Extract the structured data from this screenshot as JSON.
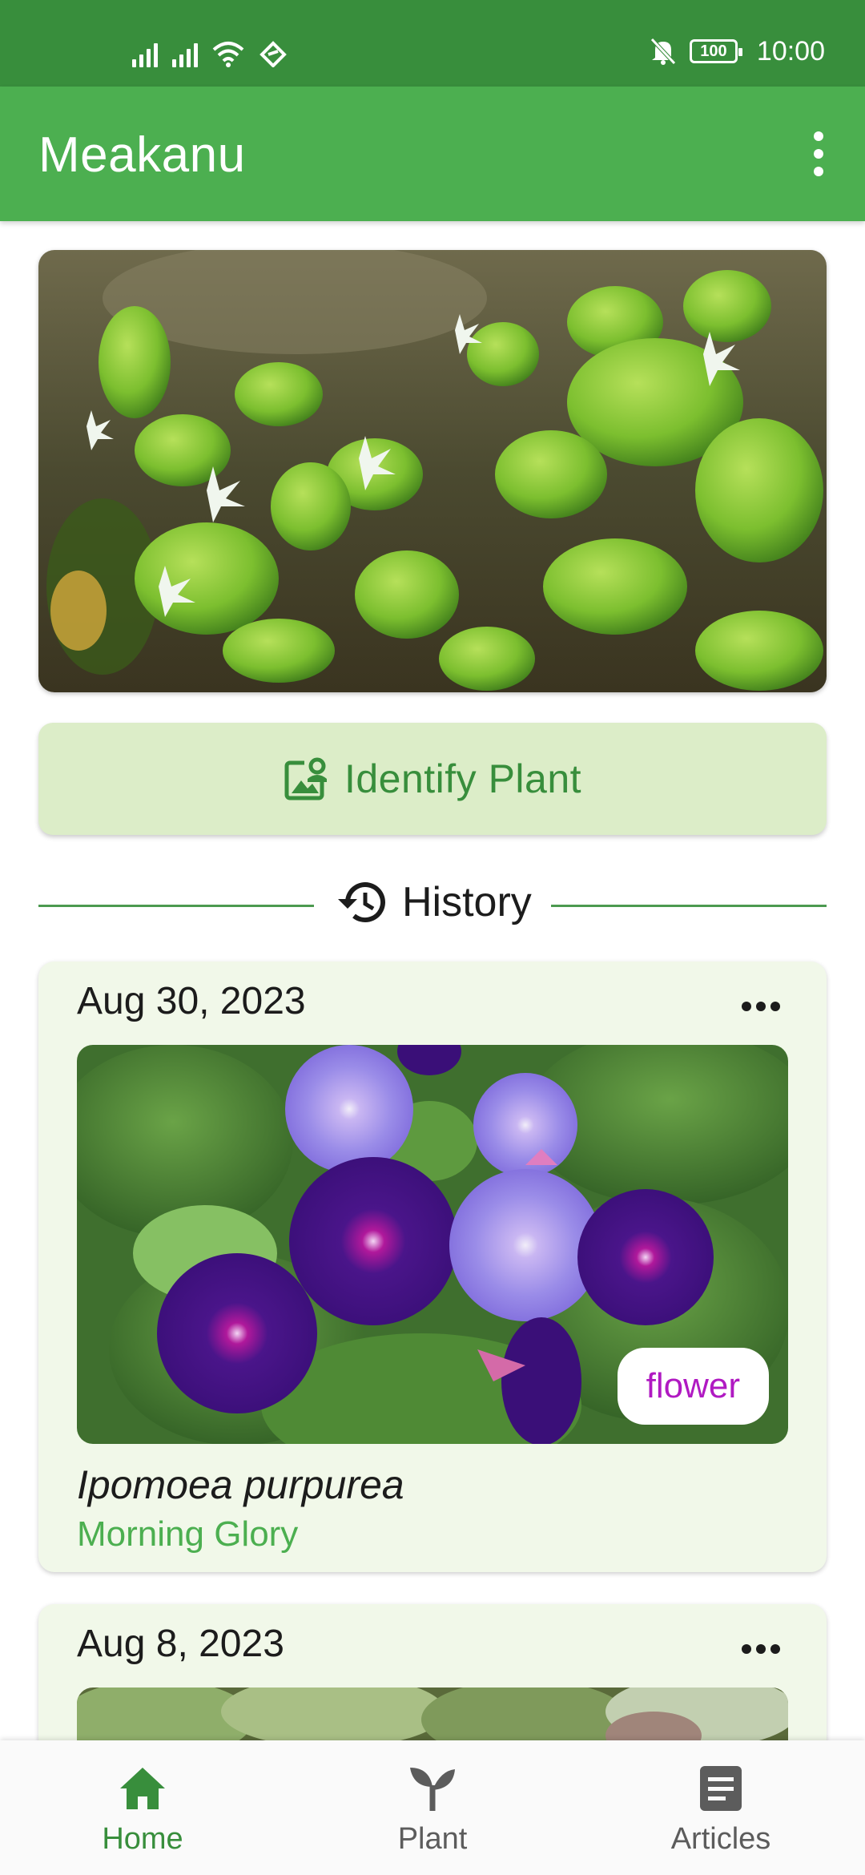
{
  "status_bar": {
    "time": "10:00",
    "battery": "100",
    "icons": [
      "signal-icon",
      "signal-icon",
      "wifi-icon",
      "nfc-icon",
      "mute-icon",
      "battery-icon"
    ]
  },
  "app_bar": {
    "title": "Meakanu",
    "menu_icon": "more-vertical-icon"
  },
  "identify_button": {
    "label": "Identify Plant",
    "icon": "image-search-icon"
  },
  "history": {
    "label": "History",
    "icon": "history-icon"
  },
  "cards": [
    {
      "date": "Aug 30, 2023",
      "tag": "flower",
      "scientific_name": "Ipomoea purpurea",
      "common_name": "Morning Glory"
    },
    {
      "date": "Aug 8, 2023"
    }
  ],
  "bottom_nav": [
    {
      "label": "Home",
      "icon": "home-icon",
      "active": true
    },
    {
      "label": "Plant",
      "icon": "sprout-icon",
      "active": false
    },
    {
      "label": "Articles",
      "icon": "article-icon",
      "active": false
    }
  ],
  "colors": {
    "status_bar": "#388e3c",
    "app_bar": "#4caf50",
    "identify_bg": "#dcedc8",
    "card_bg": "#f1f8e9",
    "tag_text": "#b01ac2",
    "common_name": "#4caf50"
  }
}
